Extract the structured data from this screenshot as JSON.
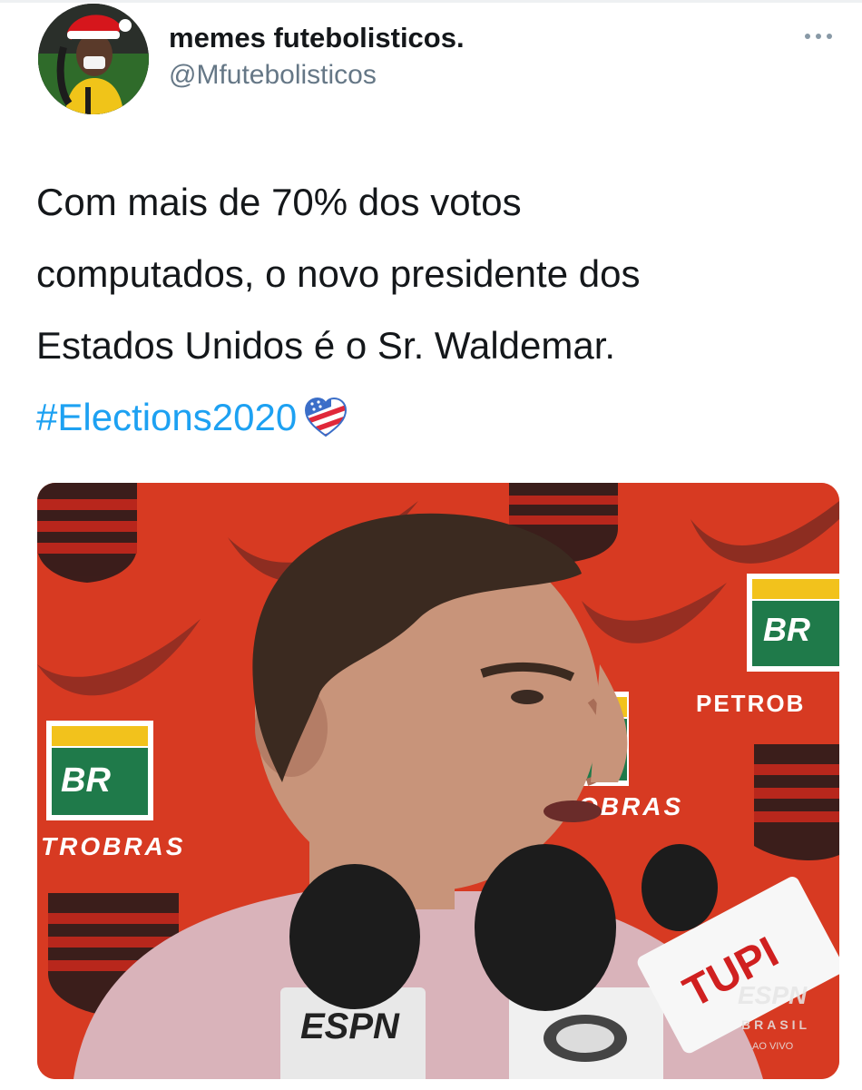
{
  "author": {
    "display_name": "memes futebolisticos.",
    "handle": "@Mfutebolisticos"
  },
  "tweet": {
    "text_lines": [
      "Com mais de 70% dos votos",
      "computados, o novo presidente dos",
      "Estados Unidos é o Sr. Waldemar."
    ],
    "hashtag": "#Elections2020",
    "hashtag_emoji": "flag-heart-icon"
  },
  "actions": {
    "more": "more-options-icon"
  },
  "media": {
    "backdrop_sponsors": [
      "BR",
      "PETROB",
      "TROBRAS",
      "OBRAS"
    ],
    "microphone_labels": [
      "TUPI",
      "ESPN",
      "BRASIL",
      "AO VIVO"
    ]
  },
  "colors": {
    "hashtag": "#1da1f2",
    "handle": "#657786",
    "text": "#14171a",
    "backdrop": "#d73a22",
    "petrobras_green": "#1f7a4a",
    "petrobras_yellow": "#f2c21c"
  }
}
